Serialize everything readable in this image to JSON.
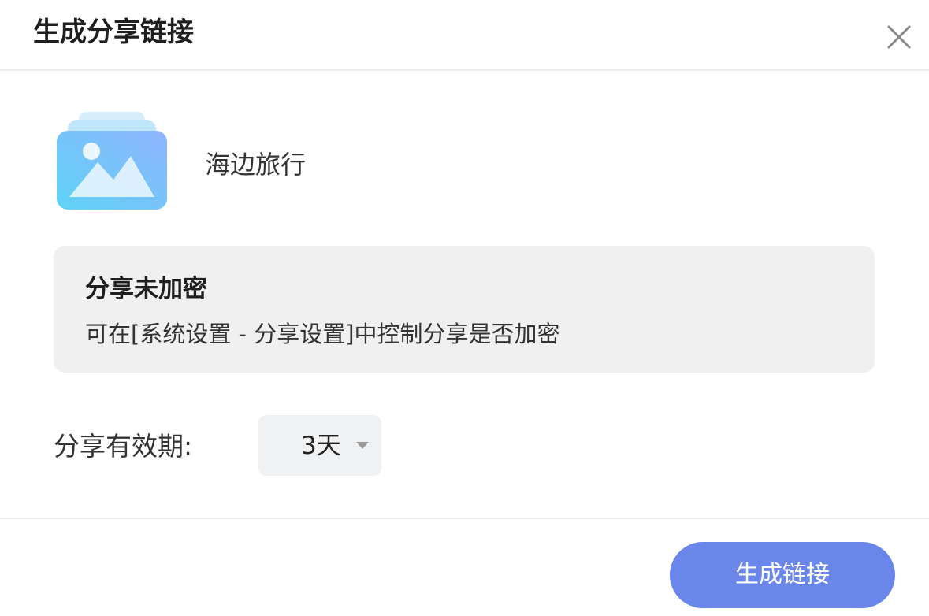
{
  "dialog": {
    "title": "生成分享链接",
    "close_icon": "close-icon"
  },
  "album": {
    "icon": "photo-album-icon",
    "name": "海边旅行",
    "colors": {
      "gradient_start": "#5fd4f6",
      "gradient_end": "#8fb4ff",
      "back_layer": "#bfe6fb"
    }
  },
  "notice": {
    "title": "分享未加密",
    "description": "可在[系统设置 - 分享设置]中控制分享是否加密"
  },
  "validity": {
    "label": "分享有效期:",
    "selected": "3天",
    "dropdown_icon": "caret-down-icon"
  },
  "footer": {
    "generate_label": "生成链接"
  },
  "colors": {
    "accent": "#6a86ea",
    "notice_bg": "#f0f0f1",
    "select_bg": "#f0f1f3",
    "divider": "#ececec"
  }
}
